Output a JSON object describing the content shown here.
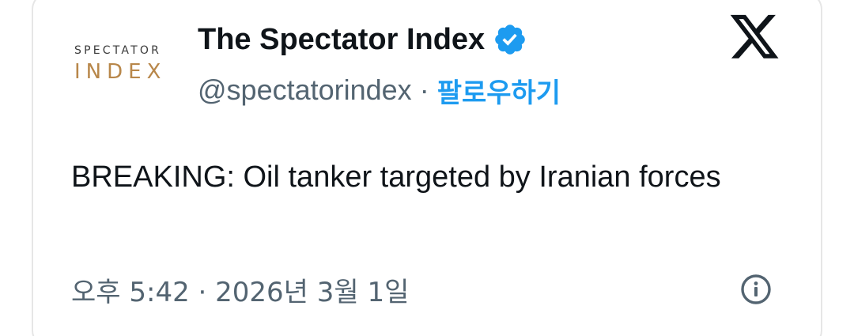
{
  "card": {
    "logo": {
      "line1": "SPECTATOR",
      "line2": "INDEX"
    },
    "author": {
      "display_name": "The Spectator Index",
      "handle": "@spectatorindex",
      "separator": "·",
      "follow_label": "팔로우하기",
      "verified": true
    },
    "tweet_text": "BREAKING: Oil tanker targeted by Iranian forces",
    "timestamp": "오후 5:42 · 2026년 3월 1일",
    "icons": {
      "platform": "x-logo-icon",
      "verified": "verified-badge-icon",
      "info": "info-icon"
    }
  },
  "colors": {
    "text_primary": "#0f1419",
    "text_secondary": "#536471",
    "accent": "#1d9bf0",
    "logo_gold": "#b8874a"
  }
}
